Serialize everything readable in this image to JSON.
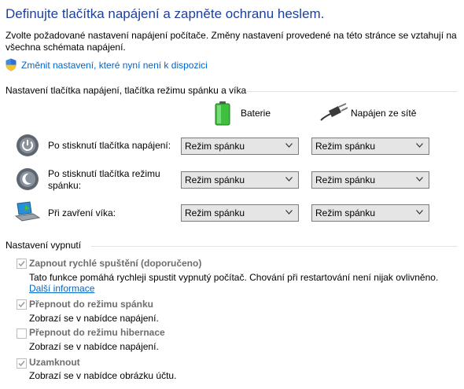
{
  "header": {
    "title": "Definujte tlačítka napájení a zapněte ochranu heslem.",
    "description": "Zvolte požadované nastavení napájení počítače. Změny nastavení provedené na této stránce se vztahují na všechna schémata napájení.",
    "change_link": "Změnit nastavení, které nyní není k dispozici"
  },
  "buttons_section": {
    "title": "Nastavení tlačítka napájení, tlačítka režimu spánku a víka",
    "columns": {
      "battery": "Baterie",
      "plugged_in": "Napájen ze sítě"
    },
    "rows": [
      {
        "label": "Po stisknutí tlačítka napájení:",
        "battery": "Režim spánku",
        "plugged_in": "Režim spánku"
      },
      {
        "label": "Po stisknutí tlačítka režimu spánku:",
        "battery": "Režim spánku",
        "plugged_in": "Režim spánku"
      },
      {
        "label": "Při zavření víka:",
        "battery": "Režim spánku",
        "plugged_in": "Režim spánku"
      }
    ]
  },
  "shutdown_section": {
    "title": "Nastavení vypnutí",
    "options": [
      {
        "label": "Zapnout rychlé spuštění (doporučeno)",
        "description": "Tato funkce pomáhá rychleji spustit vypnutý počítač. Chování při restartování není nijak ovlivněno.",
        "link": "Další informace",
        "checked": true
      },
      {
        "label": "Přepnout do režimu spánku",
        "description": "Zobrazí se v nabídce napájení.",
        "checked": true
      },
      {
        "label": "Přepnout do režimu hibernace",
        "description": "Zobrazí se v nabídce napájení.",
        "checked": false
      },
      {
        "label": "Uzamknout",
        "description": "Zobrazí se v nabídce obrázku účtu.",
        "checked": true
      }
    ]
  },
  "colors": {
    "title": "#1f3f9c",
    "link": "#0066cc",
    "disabled_text": "#6d6d6d",
    "battery_green": "#3fbf3f"
  },
  "icons": [
    "shield-icon",
    "battery-icon",
    "plug-icon",
    "power-button-icon",
    "sleep-button-icon",
    "laptop-lid-icon",
    "chevron-down-icon",
    "checkmark-icon"
  ]
}
